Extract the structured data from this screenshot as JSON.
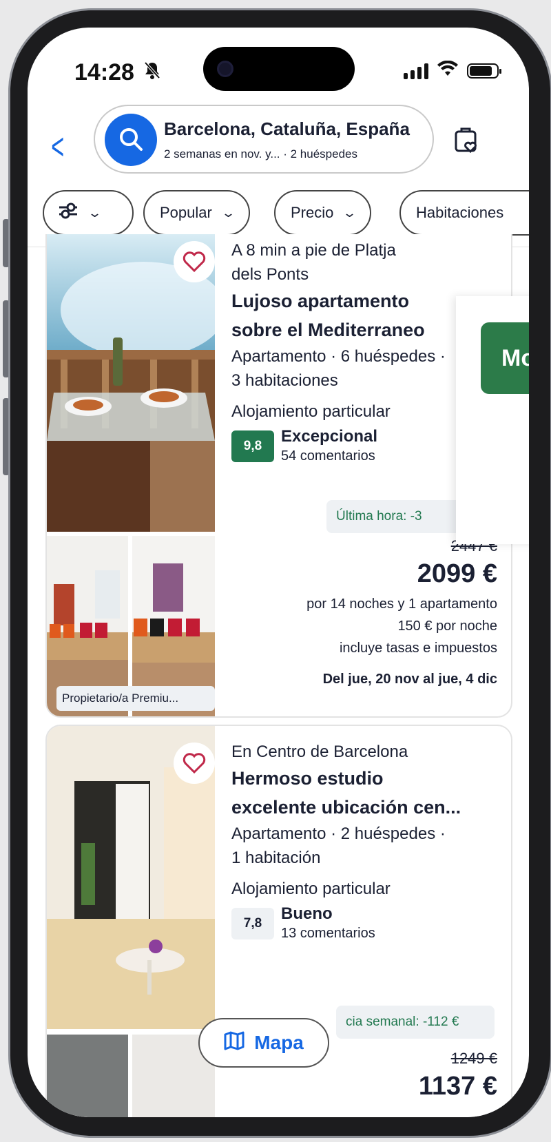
{
  "status_bar": {
    "time": "14:28"
  },
  "search": {
    "destination": "Barcelona, Cataluña, España",
    "details": "2 semanas en nov. y... · 2 huéspedes"
  },
  "filters": [
    {
      "label": ""
    },
    {
      "label": "Popular"
    },
    {
      "label": "Precio"
    },
    {
      "label": "Habitaciones"
    }
  ],
  "listings": [
    {
      "location": "A 8 min a pie de Platja dels Ponts",
      "title_line1": "Lujoso apartamento",
      "title_line2": "sobre el Mediterraneo",
      "type_line1": "Apartamento · 6 huéspedes ·",
      "type_line2": "3 habitaciones",
      "host_type": "Alojamiento particular",
      "score": "9,8",
      "rating_word": "Excepcional",
      "review_count": "54 comentarios",
      "deal": "Última hora: -3",
      "old_price": "2447 €",
      "price": "2099 €",
      "price_note": "por 14 noches y 1 apartamento",
      "nightly": "150 € por noche",
      "taxes": "incluye tasas e impuestos",
      "dates": "Del jue, 20 nov al jue, 4 dic",
      "owner_badge": "Propietario/a Premiu..."
    },
    {
      "location": "En Centro de Barcelona",
      "title_line1": "Hermoso estudio",
      "title_line2": "excelente ubicación cen...",
      "type_line1": "Apartamento · 2 huéspedes ·",
      "type_line2": "1 habitación",
      "host_type": "Alojamiento particular",
      "score": "7,8",
      "rating_word": "Bueno",
      "review_count": "13 comentarios",
      "deal": "cia semanal: -112 €",
      "old_price": "1249 €",
      "price": "1137 €"
    }
  ],
  "overlay": {
    "label": "Mol"
  },
  "map_button": {
    "label": "Mapa"
  },
  "colors": {
    "brand_blue": "#1668e3",
    "score_green": "#227950",
    "deal_green": "#227950",
    "text_dark": "#1b2033"
  }
}
